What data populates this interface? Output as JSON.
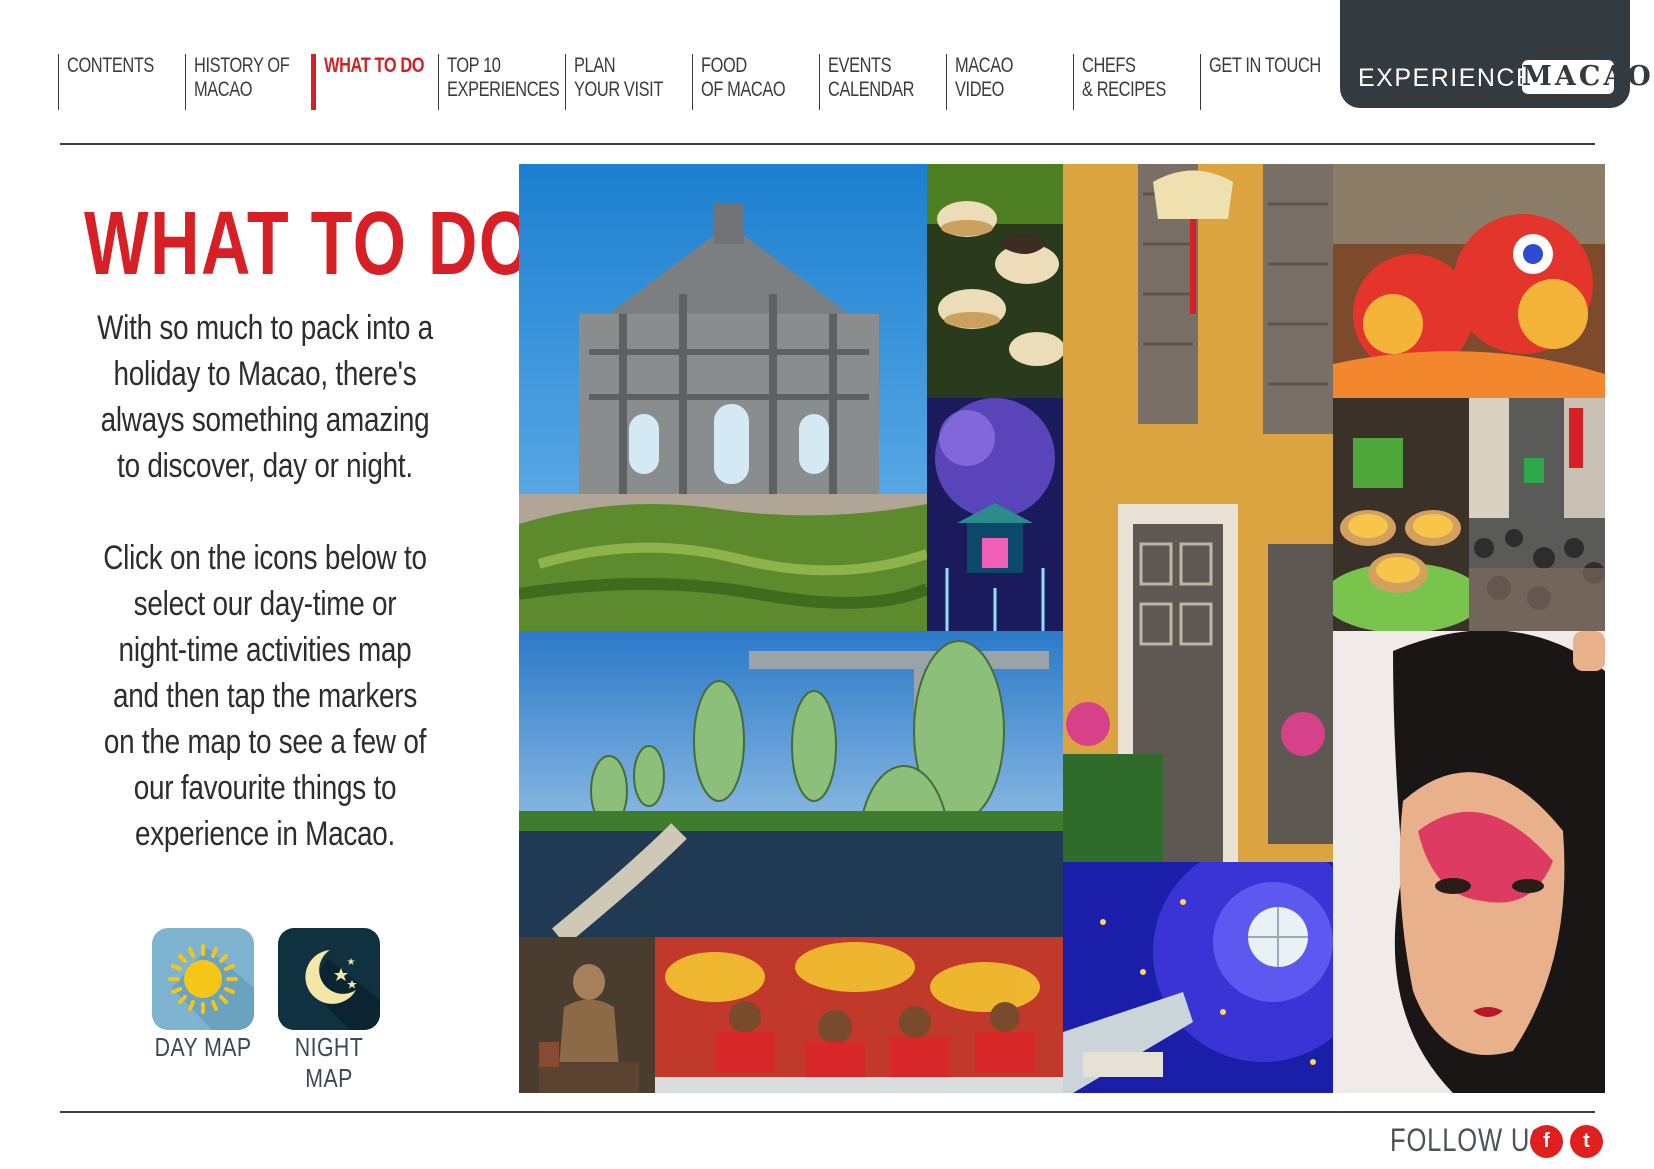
{
  "nav": {
    "items": [
      {
        "label": "CONTENTS",
        "active": false
      },
      {
        "label": "HISTORY OF\nMACAO",
        "active": false
      },
      {
        "label": "WHAT TO DO",
        "active": true
      },
      {
        "label": "TOP 10\nEXPERIENCES",
        "active": false
      },
      {
        "label": "PLAN\nYOUR VISIT",
        "active": false
      },
      {
        "label": "FOOD\nOF MACAO",
        "active": false
      },
      {
        "label": "EVENTS\nCALENDAR",
        "active": false
      },
      {
        "label": "MACAO\nVIDEO",
        "active": false
      },
      {
        "label": "CHEFS\n& RECIPES",
        "active": false
      },
      {
        "label": "GET IN TOUCH",
        "active": false
      }
    ]
  },
  "brand": {
    "prefix": "EXPERIENCE",
    "name": "MACAO"
  },
  "page": {
    "heading": "WHAT TO DO",
    "intro": "With so much to pack into a holiday to Macao, there's always something amazing to discover, day or night.",
    "instructions": "Click on the icons below to select our day-time or night-time activities map and then tap the markers on the map to see a few of our favourite things to experience in Macao."
  },
  "maps": {
    "day_label": "DAY MAP",
    "night_label": "NIGHT MAP"
  },
  "footer": {
    "follow_label": "FOLLOW US",
    "facebook_glyph": "f",
    "twitter_glyph": "t"
  },
  "colors": {
    "accent": "#d71f26",
    "brand_bg": "#333a40",
    "day_icon_bg": "#7eb4cf",
    "night_icon_bg": "#0f3140"
  },
  "icons": [
    "sun-icon",
    "moon-icon",
    "facebook-icon",
    "twitter-icon"
  ]
}
